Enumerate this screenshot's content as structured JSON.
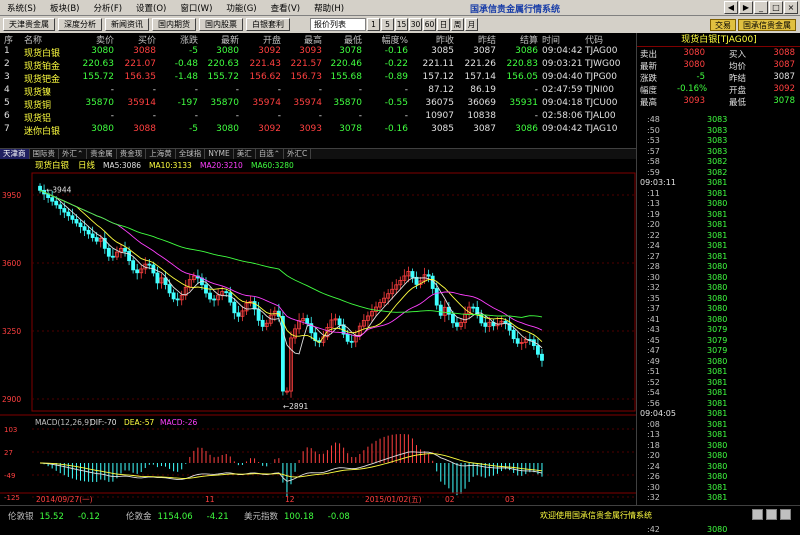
{
  "menu": [
    "系统(S)",
    "板块(B)",
    "分析(F)",
    "设置(O)",
    "窗口(W)",
    "功能(G)",
    "查看(V)",
    "帮助(H)"
  ],
  "app_title": "国承信贵金属行情系统",
  "window_controls": [
    "◀",
    "▶",
    "_",
    "□",
    "×"
  ],
  "toolbar": {
    "buttons": [
      "天津贵金属",
      "深度分析",
      "新闻资讯",
      "国内期货",
      "国内股票",
      "白银套利"
    ],
    "select_value": "报价列表",
    "num_buttons": [
      "1",
      "5",
      "15",
      "30",
      "60",
      "日",
      "周",
      "月"
    ]
  },
  "top_right_buttons": [
    "交易",
    "国承信贵金属"
  ],
  "quote_table": {
    "headers": [
      "序",
      "名称",
      "卖价",
      "买价",
      "涨跌",
      "最新",
      "开盘",
      "最高",
      "最低",
      "幅度%",
      "昨收",
      "昨结",
      "结算",
      "时间",
      "代码"
    ],
    "rows": [
      {
        "n": "1",
        "name": "现货白银",
        "sell": "3080",
        "buy": "3088",
        "chg": "-5",
        "last": "3080",
        "open": "3092",
        "high": "3093",
        "low": "3078",
        "pct": "-0.16",
        "prev": "3085",
        "prevset": "3087",
        "settle": "3086",
        "time": "09:04:42",
        "code": "TJAG00"
      },
      {
        "n": "2",
        "name": "现货铂金",
        "sell": "220.63",
        "buy": "221.07",
        "chg": "-0.48",
        "last": "220.63",
        "open": "221.43",
        "high": "221.57",
        "low": "220.46",
        "pct": "-0.22",
        "prev": "221.11",
        "prevset": "221.26",
        "settle": "220.83",
        "time": "09:03:21",
        "code": "TJWG00"
      },
      {
        "n": "3",
        "name": "现货钯金",
        "sell": "155.72",
        "buy": "156.35",
        "chg": "-1.48",
        "last": "155.72",
        "open": "156.62",
        "high": "156.73",
        "low": "155.68",
        "pct": "-0.89",
        "prev": "157.12",
        "prevset": "157.14",
        "settle": "156.05",
        "time": "09:04:40",
        "code": "TJPG00"
      },
      {
        "n": "4",
        "name": "现货镍",
        "sell": "-",
        "buy": "-",
        "chg": "-",
        "last": "-",
        "open": "-",
        "high": "-",
        "low": "-",
        "pct": "-",
        "prev": "87.12",
        "prevset": "86.19",
        "settle": "-",
        "time": "02:47:59",
        "code": "TJNI00"
      },
      {
        "n": "5",
        "name": "现货铜",
        "sell": "35870",
        "buy": "35914",
        "chg": "-197",
        "last": "35870",
        "open": "35974",
        "high": "35974",
        "low": "35870",
        "pct": "-0.55",
        "prev": "36075",
        "prevset": "36069",
        "settle": "35931",
        "time": "09:04:18",
        "code": "TJCU00"
      },
      {
        "n": "6",
        "name": "现货铝",
        "sell": "-",
        "buy": "-",
        "chg": "-",
        "last": "-",
        "open": "-",
        "high": "-",
        "low": "-",
        "pct": "-",
        "prev": "10907",
        "prevset": "10838",
        "settle": "-",
        "time": "02:58:06",
        "code": "TJAL00"
      },
      {
        "n": "7",
        "name": "迷你白银",
        "sell": "3080",
        "buy": "3088",
        "chg": "-5",
        "last": "3080",
        "open": "3092",
        "high": "3093",
        "low": "3078",
        "pct": "-0.16",
        "prev": "3085",
        "prevset": "3087",
        "settle": "3086",
        "time": "09:04:42",
        "code": "TJAG10"
      }
    ]
  },
  "bottom_tabs": [
    "天津商",
    "国际贵",
    "外汇⌃",
    "贵金属",
    "贵金现",
    "上海黄",
    "全球指",
    "NYME",
    "美汇",
    "自选⌃",
    "外汇C"
  ],
  "chart": {
    "title": "现货白银",
    "period": "日线",
    "ma": [
      {
        "label": "MA5:3086",
        "color": "#e0e0e0"
      },
      {
        "label": "MA10:3133",
        "color": "#ffff40"
      },
      {
        "label": "MA20:3210",
        "color": "#ff40ff"
      },
      {
        "label": "MA60:3280",
        "color": "#40ff40"
      }
    ],
    "y_ticks": [
      "3950",
      "3600",
      "3250",
      "2900"
    ],
    "annotations": [
      "3944",
      "2891"
    ],
    "macd_label": "MACD(12,26,9)",
    "macd_dif": "DIF:-70",
    "macd_dea": "DEA:-57",
    "macd_val": "MACD:-26",
    "macd_ticks": [
      "103",
      "27",
      "-49",
      "-125"
    ],
    "x_labels": [
      "2014/09/27(一)",
      "11",
      "12",
      "2015/01/02(五)",
      "02",
      "03"
    ]
  },
  "right_panel": {
    "title": "现货白银[TJAG00]",
    "rows": [
      {
        "l1": "卖出",
        "v1": "3080",
        "l2": "买入",
        "v2": "3088",
        "c1": "red",
        "c2": "red"
      },
      {
        "l1": "最新",
        "v1": "3080",
        "l2": "均价",
        "v2": "3087",
        "c1": "red",
        "c2": "red"
      },
      {
        "l1": "涨跌",
        "v1": "-5",
        "l2": "昨结",
        "v2": "3087",
        "c1": "grn",
        "c2": "wht"
      },
      {
        "l1": "幅度",
        "v1": "-0.16%",
        "l2": "开盘",
        "v2": "3092",
        "c1": "grn",
        "c2": "red"
      },
      {
        "l1": "最高",
        "v1": "3093",
        "l2": "最低",
        "v2": "3078",
        "c1": "red",
        "c2": "grn"
      }
    ],
    "ticks": [
      {
        "t": ":48",
        "p": "3083"
      },
      {
        "t": ":50",
        "p": "3083"
      },
      {
        "t": ":53",
        "p": "3083"
      },
      {
        "t": ":57",
        "p": "3083"
      },
      {
        "t": ":58",
        "p": "3082"
      },
      {
        "t": ":59",
        "p": "3082"
      },
      {
        "t": "09:03:11",
        "p": "3081",
        "time": true
      },
      {
        "t": ":11",
        "p": "3081"
      },
      {
        "t": ":13",
        "p": "3080"
      },
      {
        "t": ":19",
        "p": "3081"
      },
      {
        "t": ":20",
        "p": "3081"
      },
      {
        "t": ":22",
        "p": "3081"
      },
      {
        "t": ":24",
        "p": "3081"
      },
      {
        "t": ":27",
        "p": "3081"
      },
      {
        "t": ":28",
        "p": "3080"
      },
      {
        "t": ":30",
        "p": "3080"
      },
      {
        "t": ":32",
        "p": "3080"
      },
      {
        "t": ":35",
        "p": "3080"
      },
      {
        "t": ":37",
        "p": "3080"
      },
      {
        "t": ":41",
        "p": "3080"
      },
      {
        "t": ":43",
        "p": "3079"
      },
      {
        "t": ":45",
        "p": "3079"
      },
      {
        "t": ":47",
        "p": "3079"
      },
      {
        "t": ":49",
        "p": "3080"
      },
      {
        "t": ":51",
        "p": "3081"
      },
      {
        "t": ":52",
        "p": "3081"
      },
      {
        "t": ":54",
        "p": "3081"
      },
      {
        "t": ":56",
        "p": "3081"
      },
      {
        "t": "09:04:05",
        "p": "3081",
        "time": true
      },
      {
        "t": ":08",
        "p": "3081"
      },
      {
        "t": ":13",
        "p": "3081"
      },
      {
        "t": ":18",
        "p": "3080"
      },
      {
        "t": ":20",
        "p": "3080"
      },
      {
        "t": ":24",
        "p": "3080"
      },
      {
        "t": ":26",
        "p": "3080"
      },
      {
        "t": ":30",
        "p": "3081"
      },
      {
        "t": ":32",
        "p": "3081"
      },
      {
        "t": ":36",
        "p": "3080"
      },
      {
        "t": ":38",
        "p": "3080"
      },
      {
        "t": ":42",
        "p": "3080"
      }
    ]
  },
  "status": {
    "items": [
      {
        "label": "伦敦银",
        "val": "15.52",
        "chg": "-0.12"
      },
      {
        "label": "伦敦金",
        "val": "1154.06",
        "chg": "-4.21"
      },
      {
        "label": "美元指数",
        "val": "100.18",
        "chg": "-0.08"
      }
    ],
    "marquee": "欢迎使用国承信贵金属行情系统"
  }
}
